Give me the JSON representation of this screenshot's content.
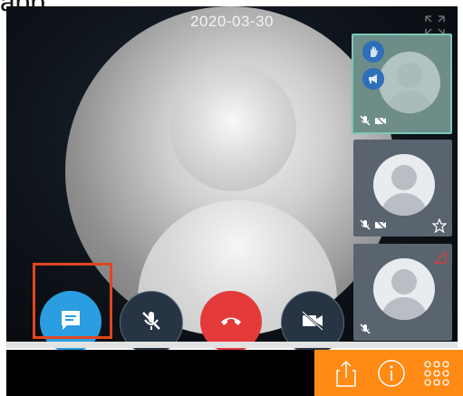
{
  "caption_fragment": "app.",
  "call": {
    "date": "2020-03-30"
  },
  "controls": {
    "chat": "chat-bubble",
    "mic": "mic-muted",
    "end": "end-call",
    "camera": "camera-off"
  },
  "participants": [
    {
      "status_icons": [
        "hand-raised",
        "megaphone",
        "mic-off",
        "camera-off"
      ],
      "active": true
    },
    {
      "status_icons": [
        "mic-off",
        "camera-off",
        "star-outline"
      ],
      "active": false
    },
    {
      "status_icons": [
        "mic-off",
        "signal-triangle"
      ],
      "active": false
    }
  ],
  "toolbar": {
    "icons": [
      "share-icon",
      "info-icon",
      "grid-menu-icon"
    ]
  },
  "colors": {
    "orange": "#ff8a14",
    "chat_blue": "#2a9ee0",
    "end_red": "#e53a3a",
    "highlight": "#e1461e"
  }
}
